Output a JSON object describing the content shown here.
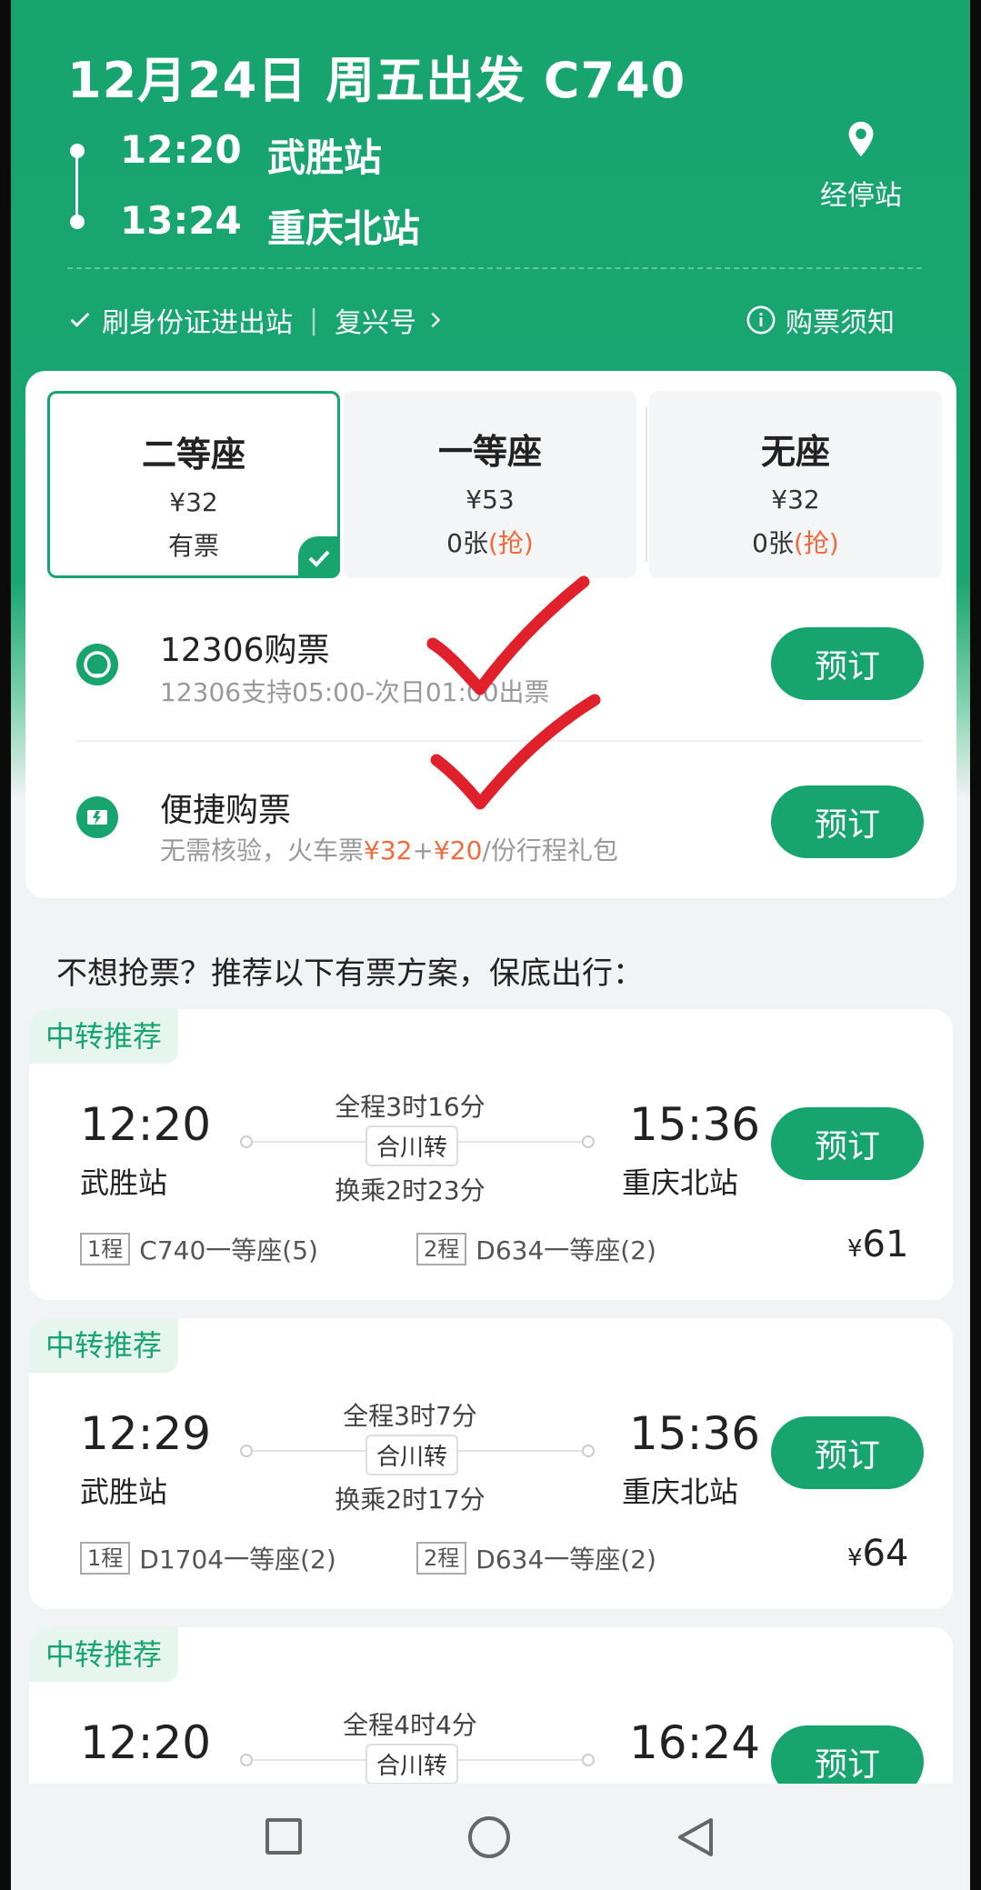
{
  "header": {
    "title": "12月24日 周五出发 C740",
    "depart_time": "12:20",
    "depart_station": "武胜站",
    "arrive_time": "13:24",
    "arrive_station": "重庆北站",
    "stops_label": "经停站",
    "id_entry_label": "刷身份证进出站",
    "train_type_label": "复兴号",
    "purchase_notice_label": "购票须知"
  },
  "seats": [
    {
      "name": "二等座",
      "price": "¥32",
      "status": "有票",
      "grab": "",
      "selected": true
    },
    {
      "name": "一等座",
      "price": "¥53",
      "status": "0张",
      "grab": "(抢)",
      "selected": false
    },
    {
      "name": "无座",
      "price": "¥32",
      "status": "0张",
      "grab": "(抢)",
      "selected": false
    }
  ],
  "options": [
    {
      "title": "12306购票",
      "subtitle": "12306支持05:00-次日01:00出票",
      "button": "预订",
      "icon": "railway-logo-icon"
    },
    {
      "title": "便捷购票",
      "subtitle_prefix": "无需核验，火车票",
      "price1": "¥32",
      "plus": "+",
      "price2": "¥20",
      "subtitle_suffix": "/份行程礼包",
      "button": "预订",
      "icon": "express-ticket-icon"
    }
  ],
  "recommend_heading": "不想抢票？推荐以下有票方案，保底出行：",
  "recommendations": [
    {
      "tag": "中转推荐",
      "dep_time": "12:20",
      "dep_station": "武胜站",
      "total": "全程3时16分",
      "transfer": "合川转",
      "wait": "换乘2时23分",
      "arr_time": "15:36",
      "arr_station": "重庆北站",
      "button": "预订",
      "leg1_tag": "1程",
      "leg1": "C740一等座(5)",
      "leg2_tag": "2程",
      "leg2": "D634一等座(2)",
      "currency": "¥",
      "price": "61"
    },
    {
      "tag": "中转推荐",
      "dep_time": "12:29",
      "dep_station": "武胜站",
      "total": "全程3时7分",
      "transfer": "合川转",
      "wait": "换乘2时17分",
      "arr_time": "15:36",
      "arr_station": "重庆北站",
      "button": "预订",
      "leg1_tag": "1程",
      "leg1": "D1704一等座(2)",
      "leg2_tag": "2程",
      "leg2": "D634一等座(2)",
      "currency": "¥",
      "price": "64"
    },
    {
      "tag": "中转推荐",
      "dep_time": "12:20",
      "total": "全程4时4分",
      "transfer": "合川转",
      "arr_time": "16:24",
      "button": "预订"
    }
  ],
  "colors": {
    "brand_green": "#18a46f",
    "accent_orange": "#f06a3c",
    "annotation_red": "#e0202a"
  }
}
